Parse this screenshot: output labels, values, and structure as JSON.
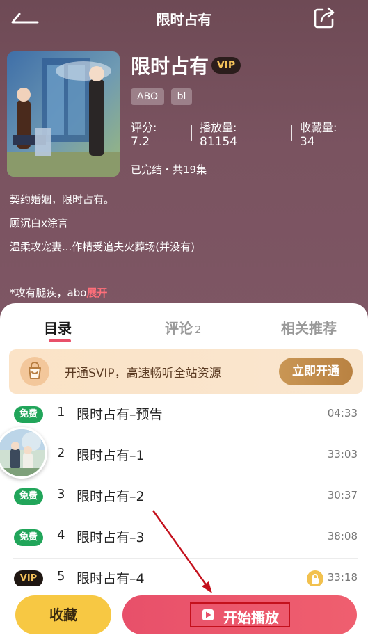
{
  "header": {
    "title": "限时占有"
  },
  "book": {
    "title": "限时占有",
    "vip_badge": "VIP",
    "tags": [
      "ABO",
      "bl"
    ],
    "stats": {
      "rating_label": "评分:",
      "rating_value": "7.2",
      "plays_label": "播放量:",
      "plays_value": "81154",
      "favorites_label": "收藏量:",
      "favorites_value": "34"
    },
    "status": "已完结・共19集",
    "description": [
      "契约婚姻，限时占有。",
      "顾沉白x涂言",
      "温柔攻宠妻...作精受追夫火葬场(并没有)",
      "*攻有腿疾，abo"
    ],
    "expand_label": "展开"
  },
  "tabs": {
    "catalog": "目录",
    "comments": "评论",
    "comments_count": "2",
    "related": "相关推荐"
  },
  "svip_banner": {
    "text": "开通SVIP，高速畅听全站资源",
    "button": "立即开通"
  },
  "episodes": [
    {
      "badge": "免费",
      "badge_type": "free",
      "num": "1",
      "title": "限时占有–预告",
      "duration": "04:33",
      "locked": false
    },
    {
      "badge": "",
      "badge_type": "none",
      "num": "2",
      "title": "限时占有–1",
      "duration": "33:03",
      "locked": false
    },
    {
      "badge": "免费",
      "badge_type": "free",
      "num": "3",
      "title": "限时占有–2",
      "duration": "30:37",
      "locked": false
    },
    {
      "badge": "免费",
      "badge_type": "free",
      "num": "4",
      "title": "限时占有–3",
      "duration": "38:08",
      "locked": false
    },
    {
      "badge": "VIP",
      "badge_type": "vip",
      "num": "5",
      "title": "限时占有–4",
      "duration": "33:18",
      "locked": true
    }
  ],
  "bottom_bar": {
    "collect": "收藏",
    "play": "开始播放"
  },
  "colors": {
    "accent": "#e8506a",
    "free_badge": "#21a55a",
    "vip_gold": "#f5c25a",
    "collect_yellow": "#f7c843",
    "annotation_red": "#c4101c"
  },
  "icons": {
    "back": "back-arrow-icon",
    "share": "share-icon",
    "svip": "shopping-bag-icon",
    "lock": "lock-icon",
    "play": "play-icon"
  }
}
